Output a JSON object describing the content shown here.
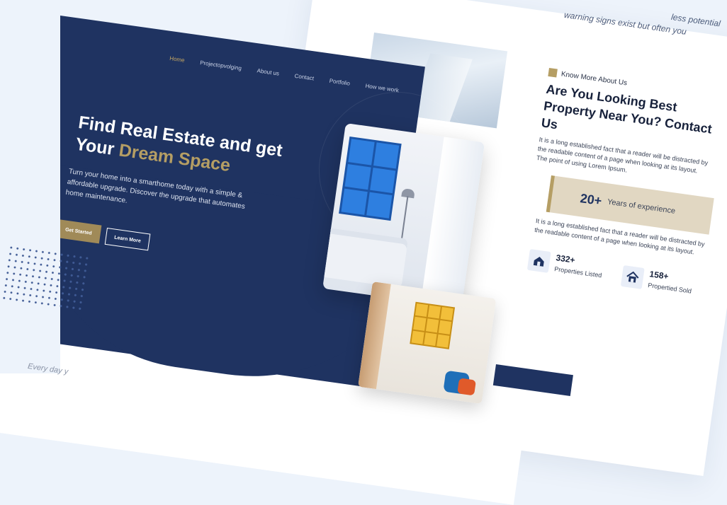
{
  "top_fade_text": {
    "line1": "less potential",
    "line2": "warning signs exist but often you"
  },
  "nav": {
    "items": [
      {
        "label": "Home",
        "active": true
      },
      {
        "label": "Projectopvolging"
      },
      {
        "label": "About us"
      },
      {
        "label": "Contact"
      },
      {
        "label": "Portfolio"
      },
      {
        "label": "How we work"
      }
    ]
  },
  "hero": {
    "title_part1": "Find Real Estate and get Your",
    "title_highlight": "Dream Space",
    "subtitle": "Turn your home into a smarthome today with a simple & affordable upgrade. Discover the upgrade that automates home maintenance.",
    "primary_button": "Get Started",
    "secondary_button": "Learn More"
  },
  "about": {
    "eyebrow": "Know More About Us",
    "title": "Are You Looking Best Property Near You? Contact Us",
    "paragraph1": "It is a long established fact that a reader will be distracted by the readable content of a page when looking at its layout. The point of using Lorem Ipsum.",
    "experience_number": "20+",
    "experience_label": "Years of experience",
    "paragraph2": "It is a long established fact that a reader will be distracted by the readable content of a page when looking at its layout."
  },
  "stats": [
    {
      "number": "332+",
      "label": "Properties Listed",
      "icon": "house-hand-icon"
    },
    {
      "number": "158+",
      "label": "Propertied Sold",
      "icon": "house-icon"
    }
  ],
  "footer_text": "Every day y",
  "colors": {
    "navy": "#1f3361",
    "gold": "#b59e64",
    "beige": "#e1d7c2",
    "background": "#edf3fb"
  }
}
